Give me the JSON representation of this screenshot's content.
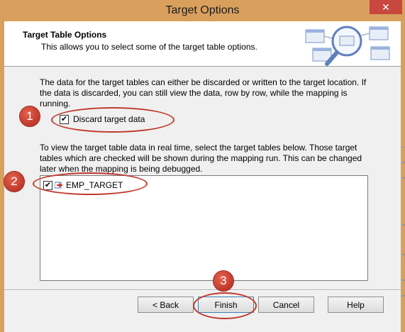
{
  "window": {
    "title": "Target Options",
    "close_label": "✕"
  },
  "header": {
    "title": "Target Table Options",
    "subtitle": "This allows you to select some of the target table options."
  },
  "discard": {
    "description": "The data for the target tables can either be discarded or written to the target location.  If the data is discarded, you can still view the data, row by row, while the mapping is running.",
    "checkbox_label": "Discard target data",
    "checked": true
  },
  "tables": {
    "description": "To view the target table data in real time, select the target tables below.  Those target tables which are checked will be shown during the mapping run.  This can be changed later when the mapping is being debugged.",
    "items": [
      {
        "label": "EMP_TARGET",
        "checked": true
      }
    ]
  },
  "buttons": {
    "back": "< Back",
    "finish": "Finish",
    "cancel": "Cancel",
    "help": "Help"
  },
  "annotations": {
    "badge1": "1",
    "badge2": "2",
    "badge3": "3",
    "color": "#c0392b"
  }
}
